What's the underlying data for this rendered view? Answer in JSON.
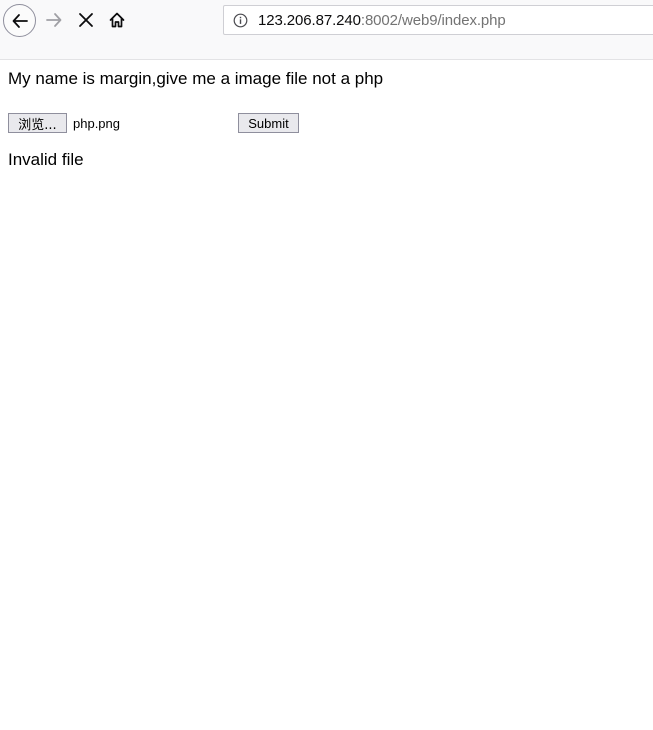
{
  "browser": {
    "url_host": "123.206.87.240",
    "url_rest": ":8002/web9/index.php",
    "icons": {
      "back": "back-arrow-icon",
      "forward": "forward-arrow-icon",
      "stop": "close-icon",
      "home": "home-icon",
      "info": "info-icon"
    }
  },
  "page": {
    "intro_text": "My name is margin,give me a image file not a php",
    "browse_label": "浏览...",
    "file_name": "php.png",
    "submit_label": "Submit",
    "result_text": "Invalid file"
  }
}
